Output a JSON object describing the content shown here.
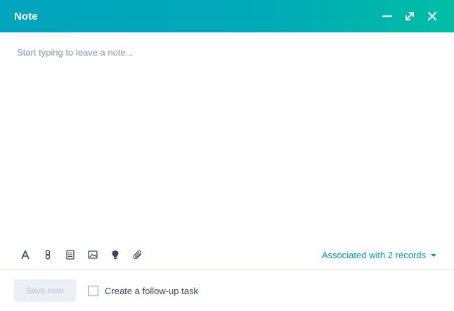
{
  "header": {
    "title": "Note",
    "minimize_icon": "minimize-icon",
    "expand_icon": "expand-icon",
    "close_icon": "close-icon"
  },
  "editor": {
    "placeholder": "Start typing to leave a note..."
  },
  "toolbar": {
    "tools": [
      "text-format-icon",
      "link-icon",
      "snippet-icon",
      "image-icon",
      "insert-icon",
      "attachment-icon"
    ],
    "associations_label": "Associated with 2 records",
    "associations_icon": "caret-down-icon"
  },
  "footer": {
    "save_label": "Save note",
    "followup_label": "Create a follow-up task",
    "followup_checked": false
  },
  "colors": {
    "header_gradient_start": "#00a4bd",
    "header_gradient_end": "#00bda5",
    "link": "#0091ae",
    "text": "#33475b",
    "placeholder": "#7c98b6"
  }
}
